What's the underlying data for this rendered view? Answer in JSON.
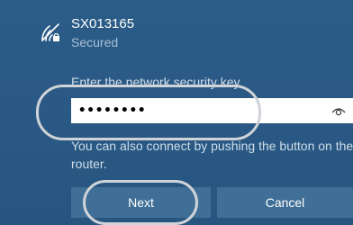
{
  "network": {
    "ssid": "SX013165",
    "security_status": "Secured",
    "icon": "wifi-secured-icon"
  },
  "prompt": {
    "label": "Enter the network security key"
  },
  "key_field": {
    "value": "••••••••",
    "reveal_icon": "eye-icon"
  },
  "help_text": "You can also connect by pushing the button on the router.",
  "buttons": {
    "next_label": "Next",
    "cancel_label": "Cancel"
  },
  "colors": {
    "panel_background": "#2a5a84",
    "button_background": "#3f6f96",
    "annotation_ring": "#d0d3d7"
  }
}
